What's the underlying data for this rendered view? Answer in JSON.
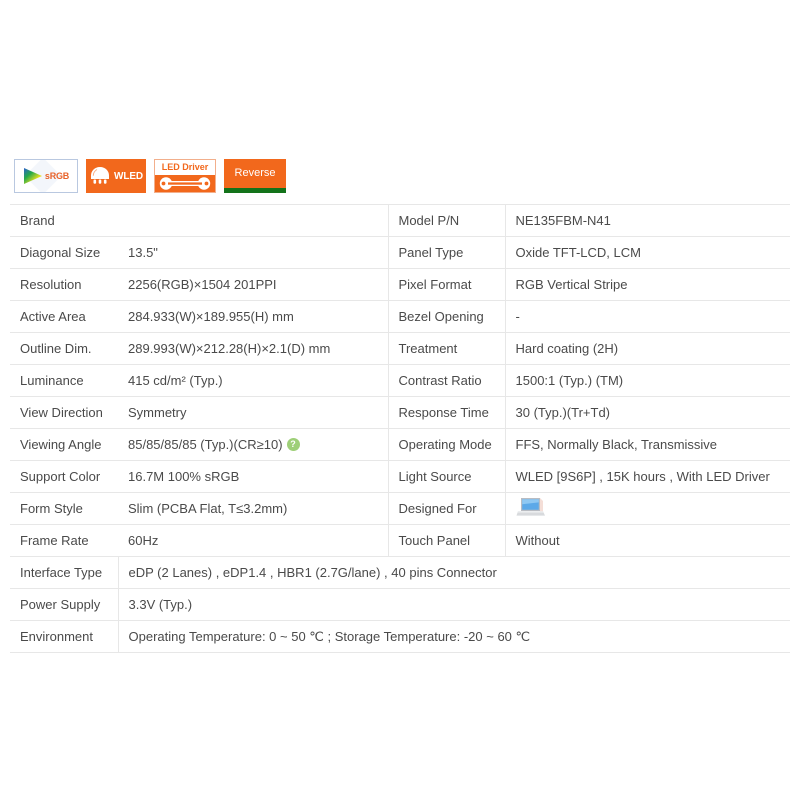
{
  "badges": [
    {
      "id": "srgb",
      "label": "sRGB",
      "icon": "color-gamut-triangle-icon",
      "text_color": "#e8622a",
      "bg": "#ffffff",
      "border": "#b9c8e0"
    },
    {
      "id": "wled",
      "label": "WLED",
      "icon": "led-bulb-icon",
      "text_color": "#ffffff",
      "bg": "#f2681c",
      "border": "#f2681c"
    },
    {
      "id": "led-driver",
      "label": "LED Driver",
      "icon": "led-driver-connector-icon",
      "text_color": "#f2681c",
      "bg": "#ffffff",
      "border": "#f2af8c"
    },
    {
      "id": "reverse",
      "label": "Reverse",
      "icon": "reverse-underline-icon",
      "text_color": "#ffffff",
      "bg": "#f2681c",
      "border": "#f2681c",
      "underline_color": "#13731a"
    }
  ],
  "spec_table": {
    "rows": [
      {
        "label": "Brand",
        "value": "",
        "label2": "Model P/N",
        "value2": "NE135FBM-N41",
        "value2_style": "link"
      },
      {
        "label": "Diagonal Size",
        "value": "13.5\"",
        "label2": "Panel Type",
        "value2": "Oxide TFT-LCD, LCM",
        "value_style": "accent"
      },
      {
        "label": "Resolution",
        "value": "2256(RGB)×1504  201PPI",
        "label2": "Pixel Format",
        "value2": "RGB Vertical Stripe"
      },
      {
        "label": "Active Area",
        "value": "284.933(W)×189.955(H) mm",
        "label2": "Bezel Opening",
        "value2": "-"
      },
      {
        "label": "Outline Dim.",
        "value": "289.993(W)×212.28(H)×2.1(D) mm",
        "label2": "Treatment",
        "value2": "Hard coating (2H)"
      },
      {
        "label": "Luminance",
        "value": "415 cd/m² (Typ.)",
        "label2": "Contrast Ratio",
        "value2": "1500:1 (Typ.) (TM)"
      },
      {
        "label": "View Direction",
        "value": "Symmetry",
        "label2": "Response Time",
        "value2": "30 (Typ.)(Tr+Td)"
      },
      {
        "label": "Viewing Angle",
        "value": "85/85/85/85 (Typ.)(CR≥10)",
        "label2": "Operating Mode",
        "value2": "FFS, Normally Black, Transmissive",
        "help_icon": "?"
      },
      {
        "label": "Support Color",
        "value": "16.7M   100% sRGB",
        "label2": "Light Source",
        "value2": "WLED  [9S6P] , 15K hours , With LED Driver"
      },
      {
        "label": "Form Style",
        "value": "Slim (PCBA Flat, T≤3.2mm)",
        "label2": "Designed For",
        "value2": "",
        "value2_icon": "laptop-icon"
      },
      {
        "label": "Frame Rate",
        "value": "60Hz",
        "label2": "Touch Panel",
        "value2": "Without"
      }
    ],
    "full_width_rows": [
      {
        "label": "Interface Type",
        "value": "eDP (2 Lanes) , eDP1.4 , HBR1 (2.7G/lane) , 40 pins Connector"
      },
      {
        "label": "Power Supply",
        "value": "3.3V (Typ.)"
      },
      {
        "label": "Environment",
        "value": "Operating Temperature: 0 ~ 50 ℃ ; Storage Temperature: -20 ~ 60 ℃"
      }
    ]
  },
  "colors": {
    "accent_orange": "#f2681c",
    "link_blue": "#3f5372",
    "help_green": "#9ecf78",
    "reverse_green": "#13731a",
    "border_gray": "#e7e7e7",
    "text_gray": "#4a4a4a"
  }
}
